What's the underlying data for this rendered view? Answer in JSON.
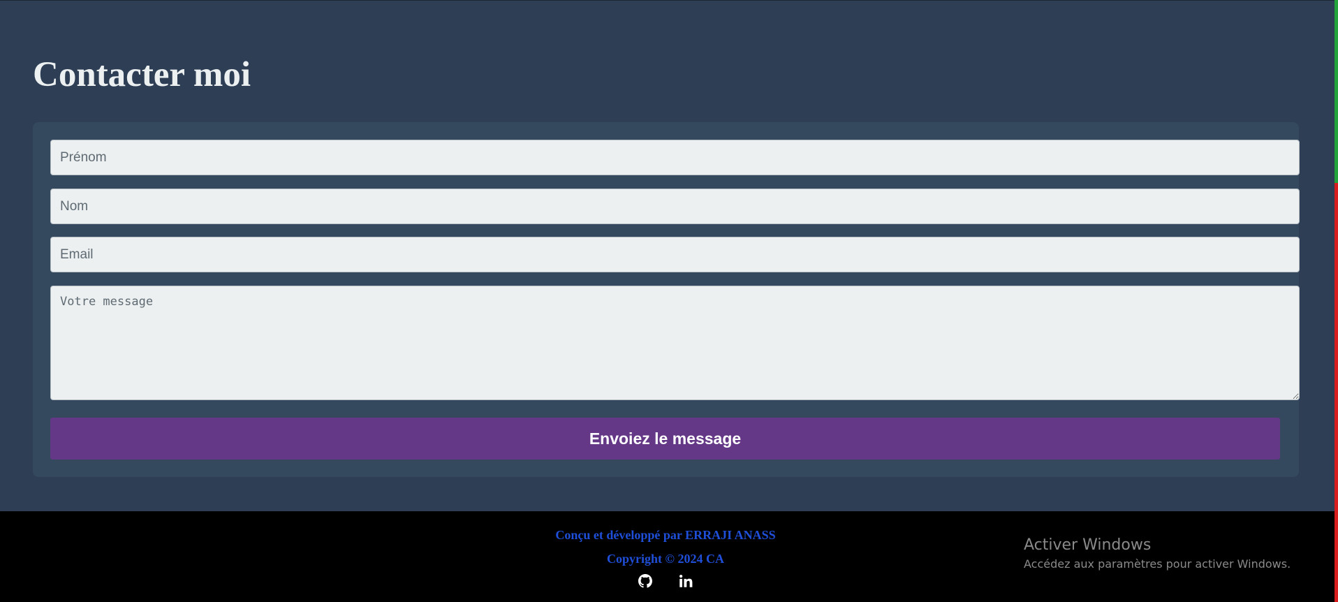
{
  "contact": {
    "title": "Contacter moi",
    "form": {
      "firstname_placeholder": "Prénom",
      "lastname_placeholder": "Nom",
      "email_placeholder": "Email",
      "message_placeholder": "Votre message",
      "submit_label": "Envoiez le message"
    }
  },
  "footer": {
    "designed_by": "Conçu et développé par ERRAJI ANASS",
    "copyright": "Copyright © 2024 CA",
    "social": [
      {
        "icon": "github-icon"
      },
      {
        "icon": "linkedin-icon"
      }
    ]
  },
  "os_overlay": {
    "activate_title": "Activer Windows",
    "activate_sub": "Accédez aux paramètres pour activer Windows."
  },
  "colors": {
    "section_bg": "#2e3f55",
    "card_bg": "#34495e",
    "button_bg": "#643787",
    "footer_text": "#1f4fd8"
  }
}
